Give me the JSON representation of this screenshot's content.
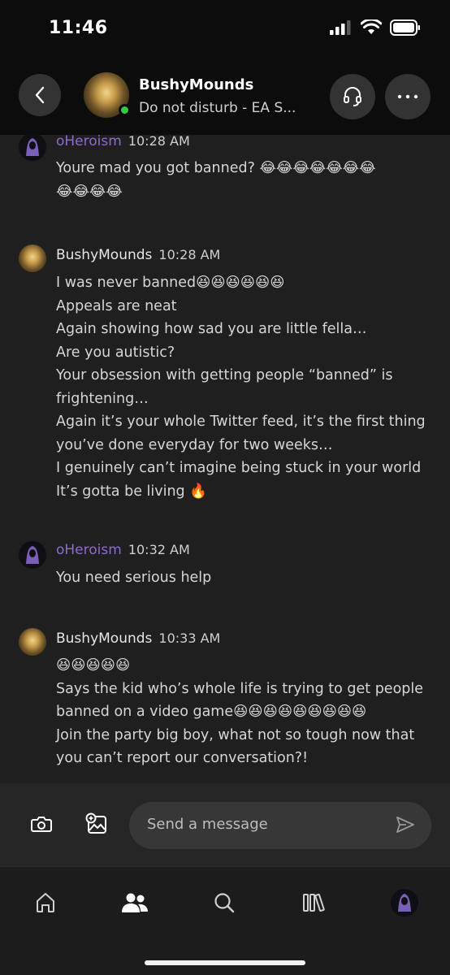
{
  "status_bar": {
    "time": "11:46"
  },
  "header": {
    "contact_name": "BushyMounds",
    "contact_status": "Do not disturb - EA S..."
  },
  "messages": [
    {
      "author": "oHeroism",
      "time": "10:28 AM",
      "lines": [
        "Youre mad you got banned? 😂😂😂😂😂😂😂",
        "😂😂😂😂"
      ]
    },
    {
      "author": "BushyMounds",
      "time": "10:28 AM",
      "lines": [
        "I was never banned😆😆😆😆😆😆",
        "Appeals are neat",
        "Again showing how sad you are little fella…",
        "Are you autistic?",
        "Your obsession with getting people “banned” is",
        "frightening…",
        "Again it’s your whole Twitter feed, it’s the first thing",
        "you’ve done everyday for two weeks…",
        "I genuinely can’t imagine being stuck in your world",
        "It’s gotta be living 🔥"
      ]
    },
    {
      "author": "oHeroism",
      "time": "10:32 AM",
      "lines": [
        "You need serious help"
      ]
    },
    {
      "author": "BushyMounds",
      "time": "10:33 AM",
      "lines": [
        "😆😆😆😆😆",
        "Says the kid who’s whole life is trying to get people",
        "banned on a video game😆😆😆😆😆😆😆😆😆",
        "Join the party big boy, what not so tough now that",
        "you can’t report our conversation?!"
      ]
    }
  ],
  "composer": {
    "placeholder": "Send a message"
  },
  "tabs": [
    {
      "icon": "home-icon"
    },
    {
      "icon": "people-icon"
    },
    {
      "icon": "search-icon"
    },
    {
      "icon": "library-icon"
    },
    {
      "icon": "profile-avatar"
    }
  ],
  "colors": {
    "accent_name": "#8d6ad1",
    "presence": "#2ecc40",
    "background": "#1f1f1f"
  }
}
